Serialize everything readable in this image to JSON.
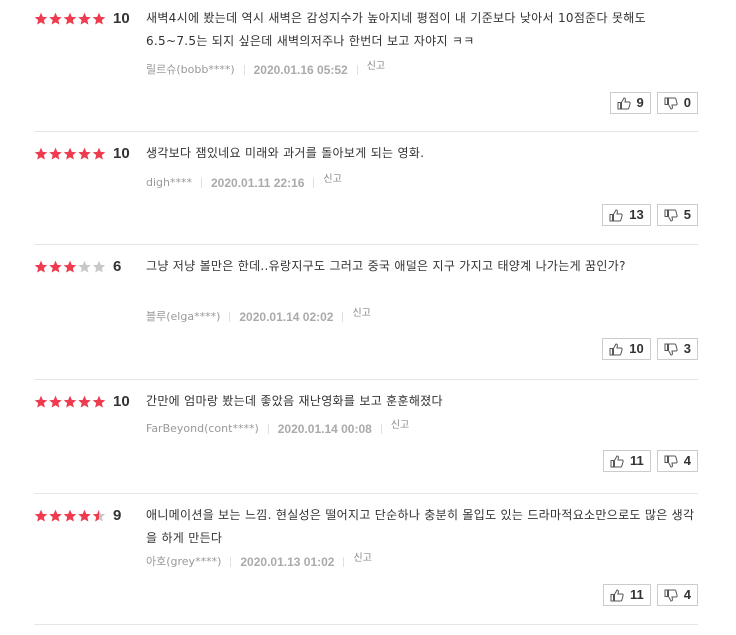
{
  "colors": {
    "star_on": "#f03a4e",
    "star_off": "#c8c8c8"
  },
  "reviews": [
    {
      "rating": 10,
      "score_label": "10",
      "text": "새벽4시에 봤는데 역시 새벽은 감성지수가 높아지네 평점이 내 기준보다 낮아서 10점준다 못해도 6.5~7.5는 되지 싶은데 새벽의저주나 한번더 보고 자야지 ㅋㅋ",
      "writer": "릴르슈(bobb****)",
      "date": "2020.01.16 05:52",
      "report": "신고",
      "likes": "9",
      "dislikes": "0"
    },
    {
      "rating": 10,
      "score_label": "10",
      "text": "생각보다 잼있네요 미래와 과거를 돌아보게 되는 영화.",
      "writer": "digh****",
      "date": "2020.01.11 22:16",
      "report": "신고",
      "likes": "13",
      "dislikes": "5"
    },
    {
      "rating": 6,
      "score_label": "6",
      "text": "그냥 저냥 볼만은 한데..유랑지구도 그러고 중국 애덜은 지구 가지고 태양계 나가는게 꿈인가?",
      "writer": "블루(elga****)",
      "date": "2020.01.14 02:02",
      "report": "신고",
      "likes": "10",
      "dislikes": "3"
    },
    {
      "rating": 10,
      "score_label": "10",
      "text": "간만에 엄마랑 봤는데 좋았음 재난영화를 보고 훈훈해졌다",
      "writer": "FarBeyond(cont****)",
      "date": "2020.01.14 00:08",
      "report": "신고",
      "likes": "11",
      "dislikes": "4"
    },
    {
      "rating": 9,
      "score_label": "9",
      "text": "애니메이션을 보는 느낌. 현실성은 떨어지고 단순하나 충분히 몰입도 있는 드라마적요소만으로도 많은 생각을 하게 만든다",
      "writer": "아호(grey****)",
      "date": "2020.01.13 01:02",
      "report": "신고",
      "likes": "11",
      "dislikes": "4"
    }
  ]
}
